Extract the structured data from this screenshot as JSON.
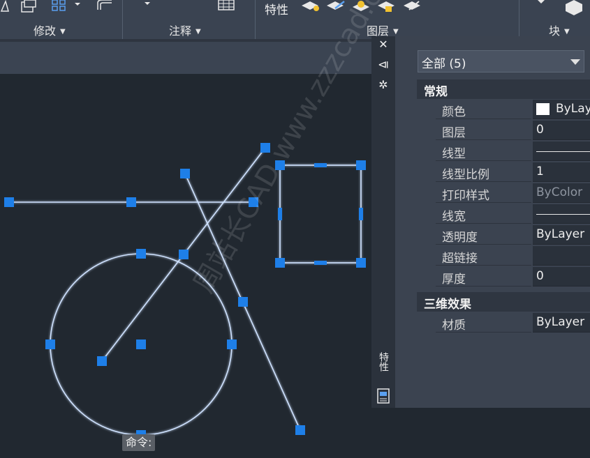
{
  "ribbon": {
    "panels": [
      {
        "label": "修改"
      },
      {
        "label": "注释"
      },
      {
        "label": "图层"
      },
      {
        "label": "块"
      }
    ],
    "properties_label": "特性"
  },
  "palette": {
    "side_title": "特性",
    "selector_value": "全部 (5)",
    "categories": [
      {
        "title": "常规"
      },
      {
        "title": "三维效果"
      }
    ],
    "general_rows": [
      {
        "name": "颜色",
        "value": "ByLayer"
      },
      {
        "name": "图层",
        "value": "0"
      },
      {
        "name": "线型",
        "value": ""
      },
      {
        "name": "线型比例",
        "value": "1"
      },
      {
        "name": "打印样式",
        "value": "ByColor"
      },
      {
        "name": "线宽",
        "value": ""
      },
      {
        "name": "透明度",
        "value": "ByLayer"
      },
      {
        "name": "超链接",
        "value": ""
      },
      {
        "name": "厚度",
        "value": "0"
      }
    ],
    "effects_rows": [
      {
        "name": "材质",
        "value": "ByLayer"
      }
    ]
  },
  "command_line": {
    "prompt": "命令:"
  },
  "watermark": {
    "text": "周站长CAD  www.zzzcad.com"
  },
  "colors": {
    "grip": "#1e7fe8",
    "entity": "#cfe2ff",
    "background": "#212830"
  }
}
